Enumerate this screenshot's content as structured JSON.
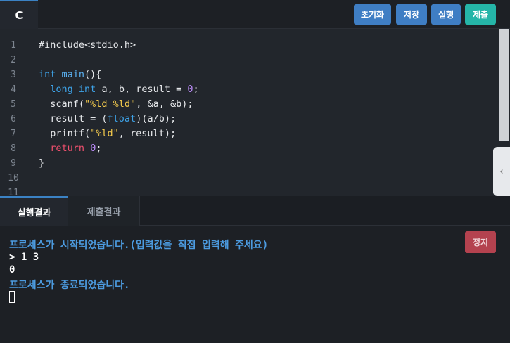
{
  "editor": {
    "language_tab": "C",
    "line_numbers": [
      "1",
      "2",
      "3",
      "4",
      "5",
      "6",
      "7",
      "8",
      "9",
      "10",
      "11"
    ]
  },
  "toolbar": {
    "reset_label": "초기화",
    "save_label": "저장",
    "run_label": "실행",
    "submit_label": "제출"
  },
  "code": {
    "l1": "#include<stdio.h>",
    "l3_type": "int",
    "l3_fn": "main",
    "l3_rest": "(){",
    "l4_indent": "  ",
    "l4_kw1": "long",
    "l4_kw2": "int",
    "l4_mid": " a, b, result = ",
    "l4_num": "0",
    "l4_end": ";",
    "l5_a": "  scanf(",
    "l5_str": "\"%ld %ld\"",
    "l5_b": ", &a, &b);",
    "l6_a": "  result = (",
    "l6_kw": "float",
    "l6_b": ")(a/b);",
    "l7_a": "  printf(",
    "l7_str": "\"%ld\"",
    "l7_b": ", result);",
    "l8_indent": "  ",
    "l8_kw": "return",
    "l8_num": "0",
    "l8_end": ";",
    "l9": "}"
  },
  "result_tabs": {
    "run_result": "실행결과",
    "submit_result": "제출결과"
  },
  "console": {
    "started": "프로세스가 시작되었습니다.(입력값을 직접 입력해 주세요)",
    "input": "> 1 3",
    "output": "0",
    "ended": "프로세스가 종료되었습니다.",
    "stop_label": "정지"
  },
  "icons": {
    "collapse": "chevron-left-icon"
  },
  "colors": {
    "button_blue": "#3f7ec4",
    "button_teal": "#25b5a8",
    "stop_red": "#b4424f",
    "info_text": "#4c9be0"
  }
}
